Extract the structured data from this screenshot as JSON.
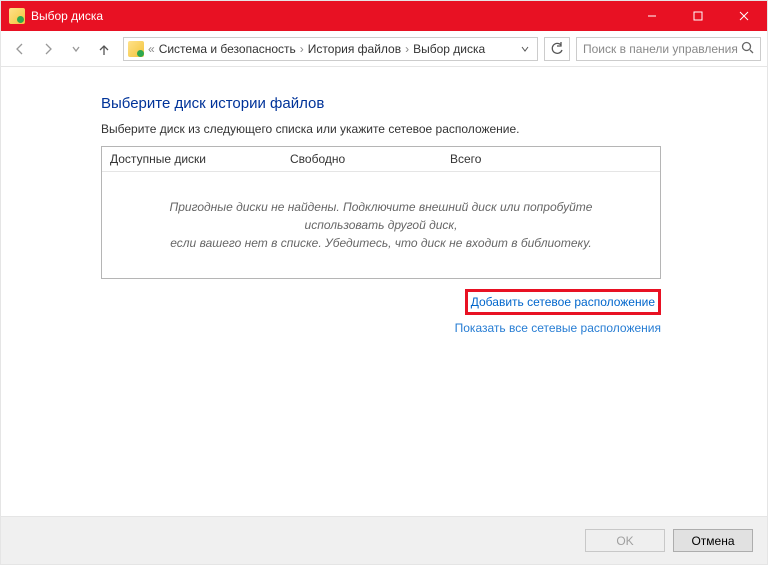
{
  "window": {
    "title": "Выбор диска"
  },
  "breadcrumb": {
    "prefix": "«",
    "items": [
      "Система и безопасность",
      "История файлов",
      "Выбор диска"
    ]
  },
  "search": {
    "placeholder": "Поиск в панели управления"
  },
  "page": {
    "heading": "Выберите диск истории файлов",
    "subtext": "Выберите диск из следующего списка или укажите сетевое расположение."
  },
  "table": {
    "col_available": "Доступные диски",
    "col_free": "Свободно",
    "col_total": "Всего",
    "empty_line1": "Пригодные диски не найдены. Подключите внешний диск или попробуйте использовать другой диск,",
    "empty_line2": "если вашего нет в списке. Убедитесь, что диск не входит в библиотеку."
  },
  "links": {
    "add_network": "Добавить сетевое расположение",
    "show_all": "Показать все сетевые расположения"
  },
  "buttons": {
    "ok": "OK",
    "cancel": "Отмена"
  }
}
